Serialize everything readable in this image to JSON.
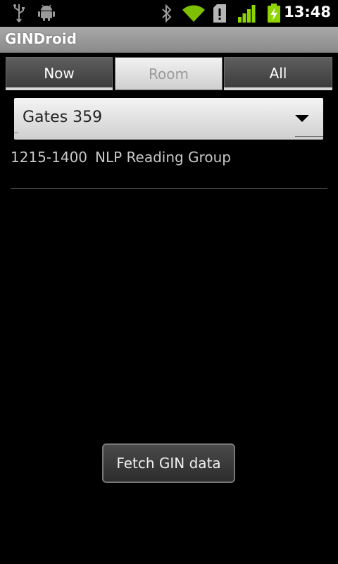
{
  "status_bar": {
    "time": "13:48",
    "icons": [
      "usb-icon",
      "android-debug-icon",
      "bluetooth-icon",
      "wifi-icon",
      "sd-card-warning-icon",
      "signal-icon",
      "battery-charging-icon"
    ],
    "colors": {
      "accent_green": "#8fd400"
    }
  },
  "app": {
    "title": "GINDroid"
  },
  "tabs": [
    {
      "label": "Now",
      "selected": false
    },
    {
      "label": "Room",
      "selected": true
    },
    {
      "label": "All",
      "selected": false
    }
  ],
  "room_spinner": {
    "selected": "Gates 359"
  },
  "events": [
    {
      "time": "1215-1400",
      "name": "NLP Reading Group"
    }
  ],
  "actions": {
    "fetch_label": "Fetch GIN data"
  }
}
